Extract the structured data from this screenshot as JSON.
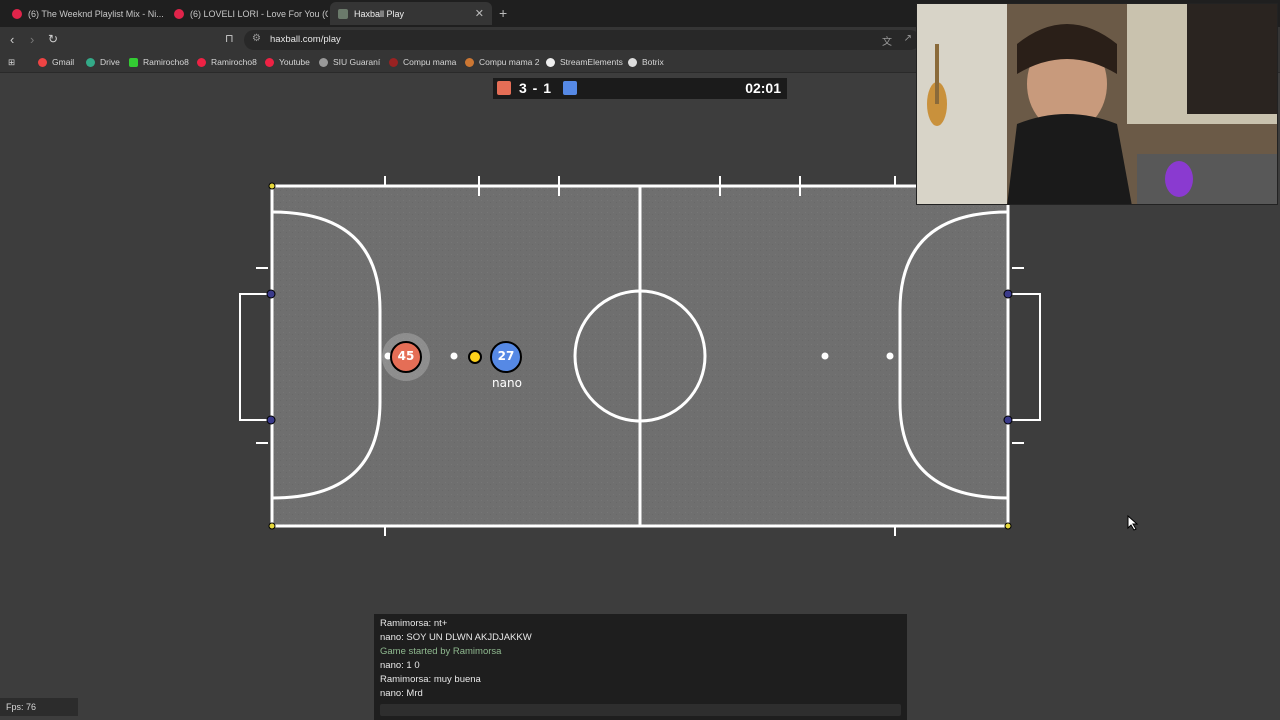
{
  "browser": {
    "tabs": [
      {
        "title": "(6) The Weeknd Playlist Mix - Ni..."
      },
      {
        "title": "(6) LOVELI LORI - Love For You (Offic..."
      },
      {
        "title": "Haxball Play"
      }
    ],
    "url": "haxball.com/play",
    "bookmarks": [
      "Gmail",
      "Drive",
      "Ramirocho8",
      "Ramirocho8",
      "Youtube",
      "SIU Guaraní",
      "Compu mama",
      "Compu mama 2",
      "StreamElements",
      "Botrix"
    ]
  },
  "game": {
    "score": "3 - 1",
    "timer": "02:01",
    "red_color": "#e56e56",
    "blue_color": "#5689e5",
    "players": [
      {
        "number": "45",
        "team": "red",
        "name": ""
      },
      {
        "number": "27",
        "team": "blue",
        "name": "nano"
      }
    ]
  },
  "chat": {
    "lines": [
      {
        "text": "Ramimorsa: nt+",
        "type": "msg"
      },
      {
        "text": "nano: SOY UN DLWN AKJDJAKKW",
        "type": "msg"
      },
      {
        "text": "Game started by Ramimorsa",
        "type": "sys"
      },
      {
        "text": "nano: 1 0",
        "type": "msg"
      },
      {
        "text": "Ramimorsa: muy buena",
        "type": "msg"
      },
      {
        "text": "nano: Mrd",
        "type": "msg"
      }
    ],
    "input_placeholder": ""
  },
  "fps": "Fps: 76"
}
